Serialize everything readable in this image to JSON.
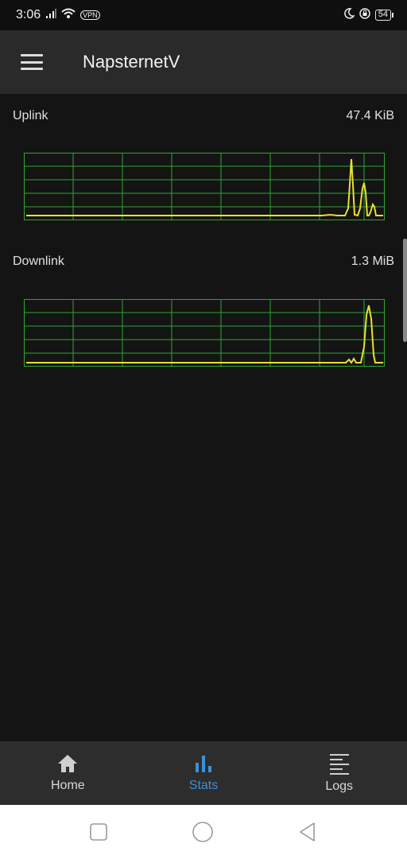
{
  "status_bar": {
    "time": "3:06",
    "vpn_label": "VPN",
    "battery": "54"
  },
  "app_bar": {
    "title": "NapsternetV",
    "menu_icon": "menu-icon"
  },
  "stats": {
    "uplink": {
      "label": "Uplink",
      "value": "47.4 KiB"
    },
    "downlink": {
      "label": "Downlink",
      "value": "1.3 MiB"
    }
  },
  "colors": {
    "grid": "#2fa52f",
    "line": "#e8e032",
    "accent": "#3d8fd8"
  },
  "bottom_nav": {
    "items": [
      {
        "label": "Home",
        "icon": "home-icon",
        "active": false
      },
      {
        "label": "Stats",
        "icon": "bar-chart-icon",
        "active": true
      },
      {
        "label": "Logs",
        "icon": "list-icon",
        "active": false
      }
    ]
  },
  "system_nav": {
    "recent": "square-icon",
    "home": "circle-icon",
    "back": "triangle-back-icon"
  }
}
